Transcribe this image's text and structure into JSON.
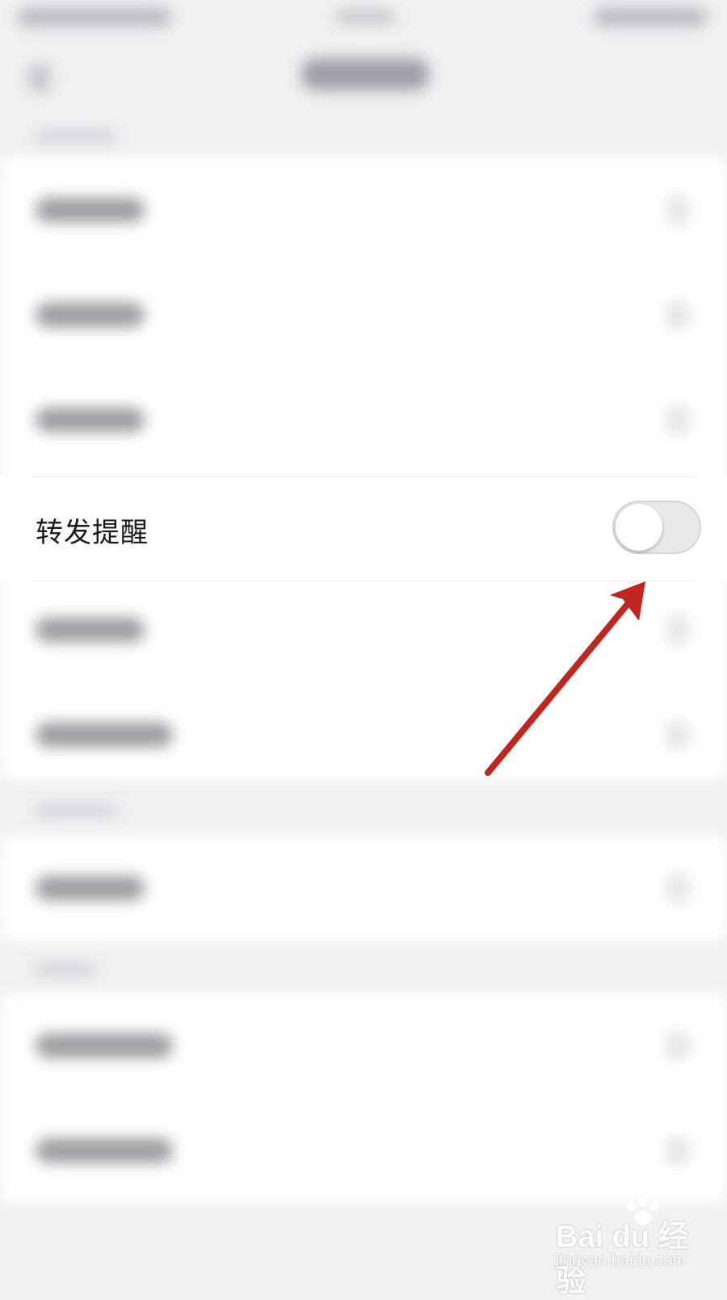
{
  "setting_row": {
    "label": "转发提醒",
    "toggle_on": false
  },
  "colors": {
    "background": "#f1f1f4",
    "group_background": "#ffffff",
    "toggle_track_off": "#e9e9eb",
    "annotation_arrow": "#c0261d"
  },
  "annotation": {
    "type": "arrow",
    "points_to": "setting_row.toggle"
  },
  "watermark": {
    "logo": "Bai du 经验",
    "url": "jingyan.baidu.com"
  }
}
